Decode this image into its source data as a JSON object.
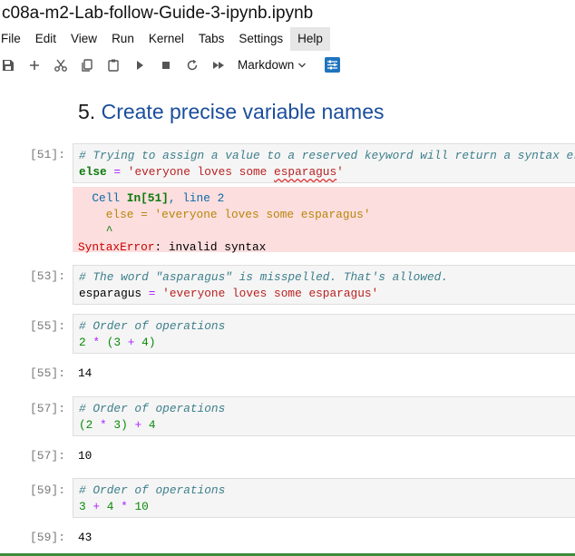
{
  "window": {
    "title": "c08a-m2-Lab-follow-Guide-3-ipynb.ipynb"
  },
  "menu": [
    "File",
    "Edit",
    "View",
    "Run",
    "Kernel",
    "Tabs",
    "Settings",
    "Help"
  ],
  "toolbar": {
    "icons": [
      "save-icon",
      "add-icon",
      "cut-icon",
      "copy-icon",
      "paste-icon",
      "run-icon",
      "stop-icon",
      "restart-icon",
      "run-all-icon",
      "settings-icon"
    ],
    "cell_type": "Markdown"
  },
  "heading": {
    "number": "5.",
    "text": "Create precise variable names"
  },
  "cells": [
    {
      "prompt": "[51]:",
      "comment": "# Trying to assign a value to a reserved keyword will return a syntax error.",
      "keyword": "else",
      "assign": " = ",
      "string_start": "'everyone loves some ",
      "string_squiggle": "esparagus",
      "string_end": "'",
      "error": {
        "header_indent": "  ",
        "header_cell": "Cell ",
        "header_in": "In[51]",
        "header_rest": ", line 2",
        "code_line": "    else = 'everyone loves some esparagus'",
        "caret": "    ^",
        "name": "SyntaxError",
        "message": ": invalid syntax"
      }
    },
    {
      "prompt": "[53]:",
      "comment": "# The word \"asparagus\" is misspelled. That's allowed.",
      "var": "esparagus",
      "op": " = ",
      "string": "'everyone loves some esparagus'"
    },
    {
      "prompt": "[55]:",
      "comment": "# Order of operations",
      "expr": [
        "2",
        " * ",
        "(3",
        " + ",
        "4)"
      ],
      "out_prompt": "[55]:",
      "output": "14"
    },
    {
      "prompt": "[57]:",
      "comment": "# Order of operations",
      "expr": [
        "(2",
        " * ",
        "3)",
        " + ",
        "4"
      ],
      "out_prompt": "[57]:",
      "output": "10"
    },
    {
      "prompt": "[59]:",
      "comment": "# Order of operations",
      "expr": [
        "3",
        " + ",
        "4",
        " * ",
        "10"
      ],
      "out_prompt": "[59]:",
      "output": "43"
    }
  ]
}
